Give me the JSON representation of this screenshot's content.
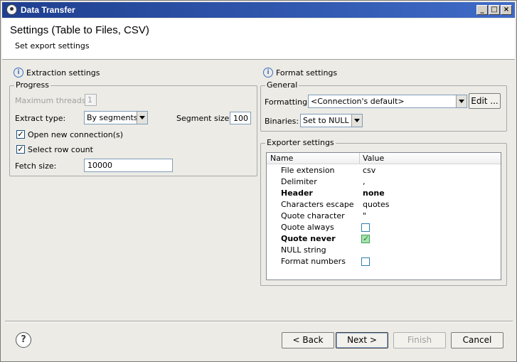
{
  "window": {
    "title": "Data Transfer"
  },
  "header": {
    "title": "Settings (Table to Files, CSV)",
    "subtitle": "Set export settings"
  },
  "extraction": {
    "section_title": "Extraction settings",
    "progress_legend": "Progress",
    "max_threads_label": "Maximum threads:",
    "max_threads_value": "1",
    "extract_type_label": "Extract type:",
    "extract_type_value": "By segments",
    "segment_size_label": "Segment size:",
    "segment_size_value": "100",
    "open_new_connection_label": "Open new connection(s)",
    "open_new_connection_checked": true,
    "select_row_count_label": "Select row count",
    "select_row_count_checked": true,
    "fetch_size_label": "Fetch size:",
    "fetch_size_value": "10000"
  },
  "format": {
    "section_title": "Format settings",
    "general_legend": "General",
    "formatting_label": "Formatting:",
    "formatting_value": "<Connection's default>",
    "edit_button": "Edit ...",
    "binaries_label": "Binaries:",
    "binaries_value": "Set to NULL",
    "exporter_legend": "Exporter settings",
    "table": {
      "col_name": "Name",
      "col_value": "Value",
      "rows": [
        {
          "name": "File extension",
          "value": "csv",
          "bold": false,
          "type": "text"
        },
        {
          "name": "Delimiter",
          "value": ",",
          "bold": false,
          "type": "text"
        },
        {
          "name": "Header",
          "value": "none",
          "bold": true,
          "type": "text"
        },
        {
          "name": "Characters escape",
          "value": "quotes",
          "bold": false,
          "type": "text"
        },
        {
          "name": "Quote character",
          "value": "\"",
          "bold": false,
          "type": "text"
        },
        {
          "name": "Quote always",
          "value": "",
          "bold": false,
          "type": "checkbox",
          "checked": false
        },
        {
          "name": "Quote never",
          "value": "",
          "bold": true,
          "type": "checkbox",
          "checked": true
        },
        {
          "name": "NULL string",
          "value": "",
          "bold": false,
          "type": "text"
        },
        {
          "name": "Format numbers",
          "value": "",
          "bold": false,
          "type": "checkbox",
          "checked": false
        }
      ]
    }
  },
  "footer": {
    "help": "?",
    "back": "< Back",
    "next": "Next >",
    "finish": "Finish",
    "cancel": "Cancel"
  }
}
